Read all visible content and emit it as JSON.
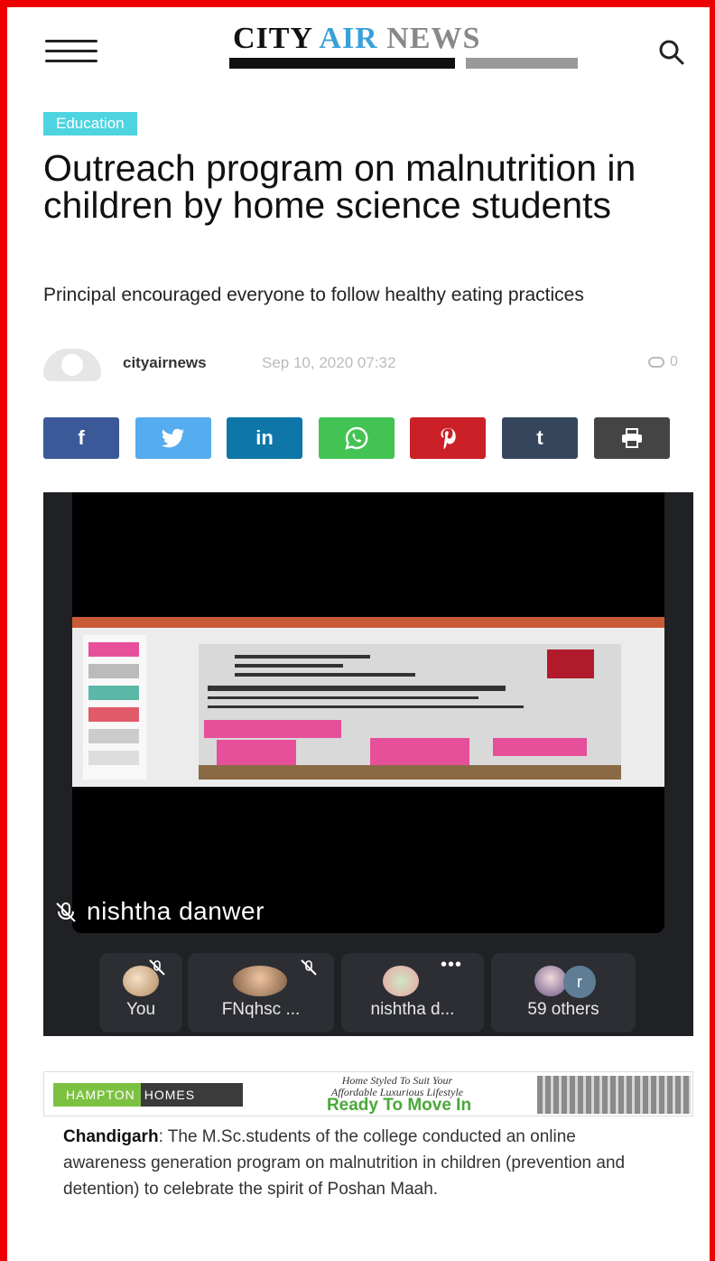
{
  "header": {
    "logo": {
      "word1": "CITY",
      "word2": "AIR",
      "word3": "NEWS"
    }
  },
  "article": {
    "category": "Education",
    "title": "Outreach program on malnutrition in children by home science students",
    "subtitle": "Principal encouraged everyone to follow healthy eating practices",
    "author": "cityairnews",
    "date": "Sep 10, 2020 07:32",
    "comment_count": "0",
    "body_lead": "Chandigarh",
    "body_text": ": The M.Sc.students of the college conducted an online awareness generation program on malnutrition in children (prevention and detention) to celebrate the spirit of Poshan Maah."
  },
  "share": [
    {
      "name": "facebook",
      "label": "f",
      "color": "#3b5998"
    },
    {
      "name": "twitter",
      "label": "",
      "color": "#55acee"
    },
    {
      "name": "linkedin",
      "label": "in",
      "color": "#0e76a8"
    },
    {
      "name": "whatsapp",
      "label": "",
      "color": "#43c353"
    },
    {
      "name": "pinterest",
      "label": "",
      "color": "#cb2027"
    },
    {
      "name": "tumblr",
      "label": "t",
      "color": "#35465c"
    },
    {
      "name": "print",
      "label": "",
      "color": "#444444"
    }
  ],
  "video": {
    "speaker": "nishtha danwer",
    "participants": [
      "You",
      "FNqhsc ...",
      "nishtha d...",
      "59 others"
    ],
    "extra_initial": "r"
  },
  "ad": {
    "brand_a": "HAMPTON",
    "brand_b": "HOMES",
    "tagline_1": "Home Styled To Suit Your",
    "tagline_2": "Affordable Luxurious Lifestyle",
    "headline": "Ready To Move In"
  }
}
